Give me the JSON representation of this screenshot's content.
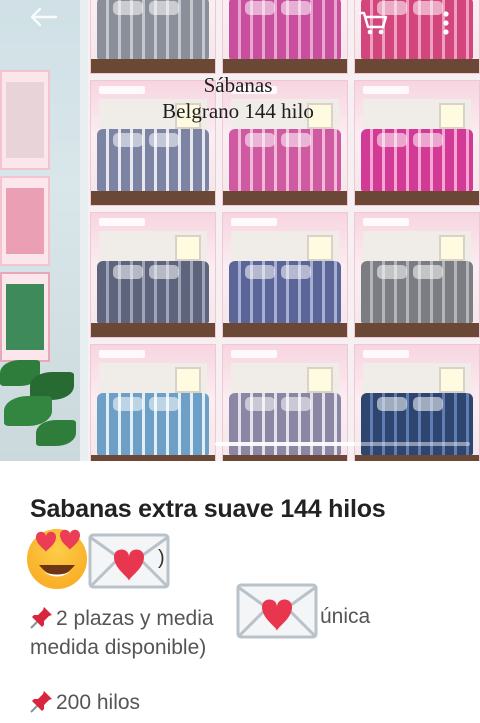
{
  "colors": {
    "accent_pink": "#e64a6b",
    "heart_red": "#e8364f",
    "envelope_gray": "#b9c2c9",
    "pin_red": "#d7263d",
    "text_dark": "#222222",
    "text_gray": "#555555"
  },
  "toolbar": {
    "back_icon": "back-arrow-icon",
    "cart_icon": "shopping-cart-icon",
    "more_icon": "more-vertical-icon"
  },
  "image": {
    "caption_line1": "Sábanas",
    "caption_line2": "Belgrano 144 hilo",
    "pager_progress": 0.55
  },
  "tiles": [
    {
      "bed": "#8a8f9a",
      "stripe": "#c5c8cf"
    },
    {
      "bed": "#c94f9e",
      "stripe": "#e7a6cf"
    },
    {
      "bed": "#d2457d",
      "stripe": "#ee9fbf"
    },
    {
      "bed": "#7d84a3",
      "stripe": "#e6e7ef"
    },
    {
      "bed": "#cf5aa2",
      "stripe": "#f0b9d8"
    },
    {
      "bed": "#d23a96",
      "stripe": "#f5a6d4"
    },
    {
      "bed": "#5d647c",
      "stripe": "#9ea5b9"
    },
    {
      "bed": "#5c6597",
      "stripe": "#a8afd4"
    },
    {
      "bed": "#7c7d82",
      "stripe": "#b4b5ba"
    },
    {
      "bed": "#6e9fc6",
      "stripe": "#e2eef7"
    },
    {
      "bed": "#8a86a3",
      "stripe": "#e3e0ec"
    },
    {
      "bed": "#2e466f",
      "stripe": "#5f7db0"
    }
  ],
  "post": {
    "title": "Sabanas extra suave 144 hilos",
    "line1_suffix": ")",
    "line2_start": "2 plazas y media",
    "line2_end": "única",
    "line3": "medida disponible)",
    "line4": "200 hilos"
  }
}
